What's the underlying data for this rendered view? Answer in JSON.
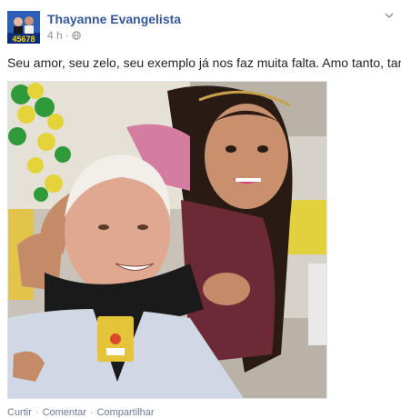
{
  "post": {
    "author_name": "Thayanne Evangelista",
    "avatar_number": "45678",
    "timestamp": "4 h",
    "separator": "·",
    "message": "Seu amor, seu zelo, seu exemplo já nos faz muita falta. Amo tanto, tanto.",
    "actions": {
      "like": "Curtir",
      "comment": "Comentar",
      "share": "Compartilhar"
    }
  },
  "icons": {
    "privacy": "globe-icon",
    "menu": "chevron-down-icon"
  },
  "colors": {
    "author_link": "#365899",
    "meta_gray": "#90949c",
    "text": "#1d2129"
  }
}
